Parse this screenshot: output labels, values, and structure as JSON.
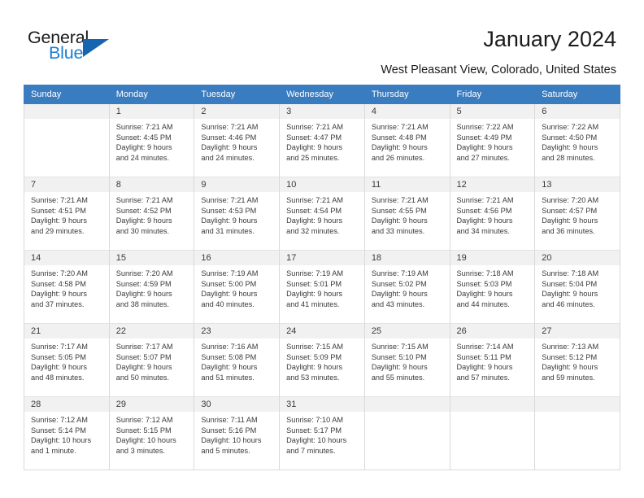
{
  "logo": {
    "word_top": "General",
    "word_bottom": "Blue",
    "triangle_color": "#1565b0",
    "blue_color": "#1b7fd4"
  },
  "header": {
    "title": "January 2024",
    "subtitle": "West Pleasant View, Colorado, United States",
    "header_bg": "#3a7cc0"
  },
  "calendar": {
    "weekdays": [
      "Sunday",
      "Monday",
      "Tuesday",
      "Wednesday",
      "Thursday",
      "Friday",
      "Saturday"
    ],
    "weeks": [
      [
        {
          "day": "",
          "sunrise": "",
          "sunset": "",
          "daylight1": "",
          "daylight2": ""
        },
        {
          "day": "1",
          "sunrise": "Sunrise: 7:21 AM",
          "sunset": "Sunset: 4:45 PM",
          "daylight1": "Daylight: 9 hours",
          "daylight2": "and 24 minutes."
        },
        {
          "day": "2",
          "sunrise": "Sunrise: 7:21 AM",
          "sunset": "Sunset: 4:46 PM",
          "daylight1": "Daylight: 9 hours",
          "daylight2": "and 24 minutes."
        },
        {
          "day": "3",
          "sunrise": "Sunrise: 7:21 AM",
          "sunset": "Sunset: 4:47 PM",
          "daylight1": "Daylight: 9 hours",
          "daylight2": "and 25 minutes."
        },
        {
          "day": "4",
          "sunrise": "Sunrise: 7:21 AM",
          "sunset": "Sunset: 4:48 PM",
          "daylight1": "Daylight: 9 hours",
          "daylight2": "and 26 minutes."
        },
        {
          "day": "5",
          "sunrise": "Sunrise: 7:22 AM",
          "sunset": "Sunset: 4:49 PM",
          "daylight1": "Daylight: 9 hours",
          "daylight2": "and 27 minutes."
        },
        {
          "day": "6",
          "sunrise": "Sunrise: 7:22 AM",
          "sunset": "Sunset: 4:50 PM",
          "daylight1": "Daylight: 9 hours",
          "daylight2": "and 28 minutes."
        }
      ],
      [
        {
          "day": "7",
          "sunrise": "Sunrise: 7:21 AM",
          "sunset": "Sunset: 4:51 PM",
          "daylight1": "Daylight: 9 hours",
          "daylight2": "and 29 minutes."
        },
        {
          "day": "8",
          "sunrise": "Sunrise: 7:21 AM",
          "sunset": "Sunset: 4:52 PM",
          "daylight1": "Daylight: 9 hours",
          "daylight2": "and 30 minutes."
        },
        {
          "day": "9",
          "sunrise": "Sunrise: 7:21 AM",
          "sunset": "Sunset: 4:53 PM",
          "daylight1": "Daylight: 9 hours",
          "daylight2": "and 31 minutes."
        },
        {
          "day": "10",
          "sunrise": "Sunrise: 7:21 AM",
          "sunset": "Sunset: 4:54 PM",
          "daylight1": "Daylight: 9 hours",
          "daylight2": "and 32 minutes."
        },
        {
          "day": "11",
          "sunrise": "Sunrise: 7:21 AM",
          "sunset": "Sunset: 4:55 PM",
          "daylight1": "Daylight: 9 hours",
          "daylight2": "and 33 minutes."
        },
        {
          "day": "12",
          "sunrise": "Sunrise: 7:21 AM",
          "sunset": "Sunset: 4:56 PM",
          "daylight1": "Daylight: 9 hours",
          "daylight2": "and 34 minutes."
        },
        {
          "day": "13",
          "sunrise": "Sunrise: 7:20 AM",
          "sunset": "Sunset: 4:57 PM",
          "daylight1": "Daylight: 9 hours",
          "daylight2": "and 36 minutes."
        }
      ],
      [
        {
          "day": "14",
          "sunrise": "Sunrise: 7:20 AM",
          "sunset": "Sunset: 4:58 PM",
          "daylight1": "Daylight: 9 hours",
          "daylight2": "and 37 minutes."
        },
        {
          "day": "15",
          "sunrise": "Sunrise: 7:20 AM",
          "sunset": "Sunset: 4:59 PM",
          "daylight1": "Daylight: 9 hours",
          "daylight2": "and 38 minutes."
        },
        {
          "day": "16",
          "sunrise": "Sunrise: 7:19 AM",
          "sunset": "Sunset: 5:00 PM",
          "daylight1": "Daylight: 9 hours",
          "daylight2": "and 40 minutes."
        },
        {
          "day": "17",
          "sunrise": "Sunrise: 7:19 AM",
          "sunset": "Sunset: 5:01 PM",
          "daylight1": "Daylight: 9 hours",
          "daylight2": "and 41 minutes."
        },
        {
          "day": "18",
          "sunrise": "Sunrise: 7:19 AM",
          "sunset": "Sunset: 5:02 PM",
          "daylight1": "Daylight: 9 hours",
          "daylight2": "and 43 minutes."
        },
        {
          "day": "19",
          "sunrise": "Sunrise: 7:18 AM",
          "sunset": "Sunset: 5:03 PM",
          "daylight1": "Daylight: 9 hours",
          "daylight2": "and 44 minutes."
        },
        {
          "day": "20",
          "sunrise": "Sunrise: 7:18 AM",
          "sunset": "Sunset: 5:04 PM",
          "daylight1": "Daylight: 9 hours",
          "daylight2": "and 46 minutes."
        }
      ],
      [
        {
          "day": "21",
          "sunrise": "Sunrise: 7:17 AM",
          "sunset": "Sunset: 5:05 PM",
          "daylight1": "Daylight: 9 hours",
          "daylight2": "and 48 minutes."
        },
        {
          "day": "22",
          "sunrise": "Sunrise: 7:17 AM",
          "sunset": "Sunset: 5:07 PM",
          "daylight1": "Daylight: 9 hours",
          "daylight2": "and 50 minutes."
        },
        {
          "day": "23",
          "sunrise": "Sunrise: 7:16 AM",
          "sunset": "Sunset: 5:08 PM",
          "daylight1": "Daylight: 9 hours",
          "daylight2": "and 51 minutes."
        },
        {
          "day": "24",
          "sunrise": "Sunrise: 7:15 AM",
          "sunset": "Sunset: 5:09 PM",
          "daylight1": "Daylight: 9 hours",
          "daylight2": "and 53 minutes."
        },
        {
          "day": "25",
          "sunrise": "Sunrise: 7:15 AM",
          "sunset": "Sunset: 5:10 PM",
          "daylight1": "Daylight: 9 hours",
          "daylight2": "and 55 minutes."
        },
        {
          "day": "26",
          "sunrise": "Sunrise: 7:14 AM",
          "sunset": "Sunset: 5:11 PM",
          "daylight1": "Daylight: 9 hours",
          "daylight2": "and 57 minutes."
        },
        {
          "day": "27",
          "sunrise": "Sunrise: 7:13 AM",
          "sunset": "Sunset: 5:12 PM",
          "daylight1": "Daylight: 9 hours",
          "daylight2": "and 59 minutes."
        }
      ],
      [
        {
          "day": "28",
          "sunrise": "Sunrise: 7:12 AM",
          "sunset": "Sunset: 5:14 PM",
          "daylight1": "Daylight: 10 hours",
          "daylight2": "and 1 minute."
        },
        {
          "day": "29",
          "sunrise": "Sunrise: 7:12 AM",
          "sunset": "Sunset: 5:15 PM",
          "daylight1": "Daylight: 10 hours",
          "daylight2": "and 3 minutes."
        },
        {
          "day": "30",
          "sunrise": "Sunrise: 7:11 AM",
          "sunset": "Sunset: 5:16 PM",
          "daylight1": "Daylight: 10 hours",
          "daylight2": "and 5 minutes."
        },
        {
          "day": "31",
          "sunrise": "Sunrise: 7:10 AM",
          "sunset": "Sunset: 5:17 PM",
          "daylight1": "Daylight: 10 hours",
          "daylight2": "and 7 minutes."
        },
        {
          "day": "",
          "sunrise": "",
          "sunset": "",
          "daylight1": "",
          "daylight2": ""
        },
        {
          "day": "",
          "sunrise": "",
          "sunset": "",
          "daylight1": "",
          "daylight2": ""
        },
        {
          "day": "",
          "sunrise": "",
          "sunset": "",
          "daylight1": "",
          "daylight2": ""
        }
      ]
    ]
  }
}
